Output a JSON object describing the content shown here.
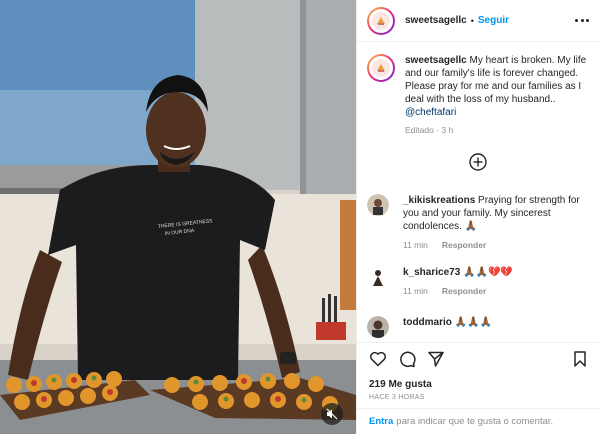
{
  "post": {
    "username": "sweetsagellc",
    "follow_label": "Seguir",
    "dot": "•"
  },
  "caption": {
    "username": "sweetsagellc",
    "text": " My heart is broken. My life and our family's life is forever changed. Please pray for me and our families as I deal with the loss of my husband.. ",
    "mention": "@cheftafari",
    "edited": "Editado · 3 h"
  },
  "comments": [
    {
      "username": "_kikiskreations",
      "text": " Praying for strength for you and your family. My sincerest condolences. 🙏🏾",
      "time": "11 min",
      "reply": "Responder"
    },
    {
      "username": "k_sharice73",
      "text": " 🙏🏾🙏🏾💔💔",
      "time": "11 min",
      "reply": "Responder"
    },
    {
      "username": "toddmario",
      "text": " 🙏🏾🙏🏾🙏🏾",
      "time": "",
      "reply": ""
    }
  ],
  "stats": {
    "likes": "219 Me gusta",
    "time_ago": "HACE 3 HORAS"
  },
  "login": {
    "link": "Entra",
    "text": "para indicar que te gusta o comentar."
  },
  "photo": {
    "shirt_text_line1": "THERE IS GREATNESS",
    "shirt_text_line2": "IN OUR DNA"
  },
  "icons": {
    "like": "heart-icon",
    "comment": "comment-icon",
    "share": "paper-plane-icon",
    "save": "bookmark-icon",
    "more": "more-options-icon",
    "add": "plus-circle-icon",
    "mute": "speaker-muted-icon"
  },
  "colors": {
    "accent": "#0095f6",
    "mention": "#00376b",
    "muted": "#8e8e8e"
  }
}
